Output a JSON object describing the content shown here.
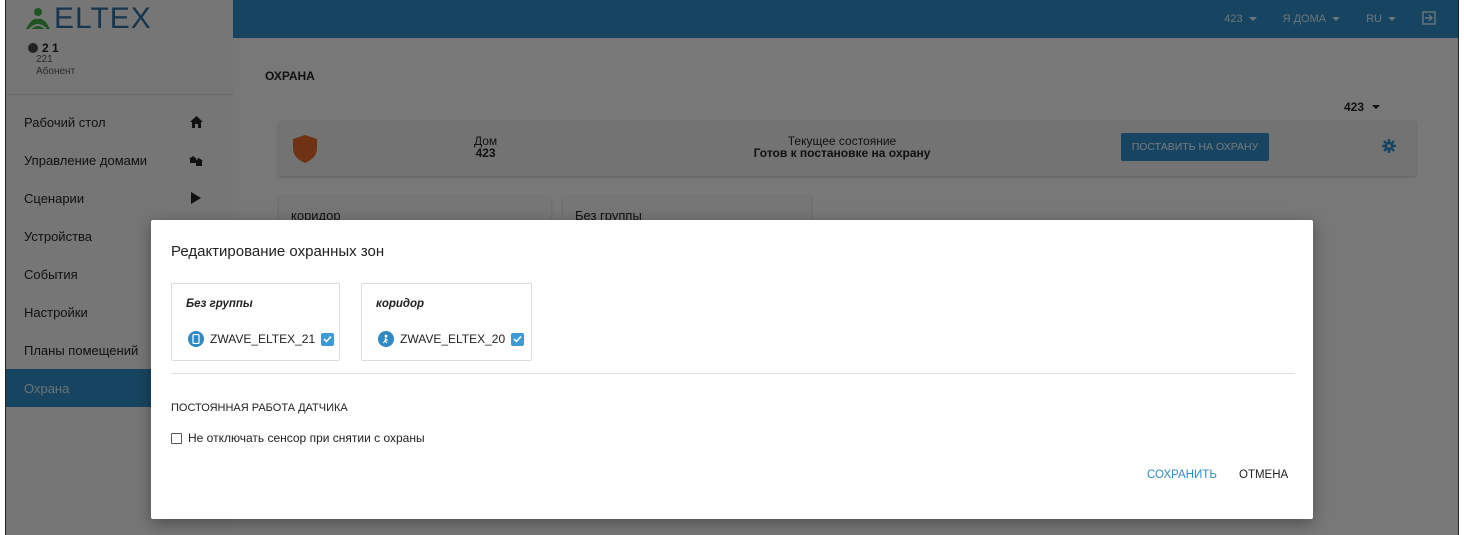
{
  "app": {
    "logo_text": "ELTEX",
    "user_number": "2 1",
    "user_id": "221",
    "user_role": "Абонент"
  },
  "sidebar": {
    "items": [
      {
        "label": "Рабочий стол",
        "icon": "home-icon"
      },
      {
        "label": "Управление домами",
        "icon": "houses-icon"
      },
      {
        "label": "Сценарии",
        "icon": "play-icon"
      },
      {
        "label": "Устройства",
        "icon": ""
      },
      {
        "label": "События",
        "icon": ""
      },
      {
        "label": "Настройки",
        "icon": ""
      },
      {
        "label": "Планы помещений",
        "icon": ""
      },
      {
        "label": "Охрана",
        "icon": "",
        "active": true
      }
    ]
  },
  "topbar": {
    "house": "423",
    "mode": "Я ДОМА",
    "lang": "RU",
    "logout_icon": "logout-icon"
  },
  "page": {
    "title": "ОХРАНА",
    "house_selector": "423",
    "guard": {
      "house_label": "Дом",
      "house_value": "423",
      "state_label": "Текущее состояние",
      "state_value": "Готов к постановке на охрану",
      "arm_button": "ПОСТАВИТЬ НА ОХРАНУ"
    },
    "zone_cards": [
      "коридор",
      "Без группы"
    ]
  },
  "modal": {
    "title": "Редактирование охранных зон",
    "zones": [
      {
        "title": "Без группы",
        "device": "ZWAVE_ELTEX_21",
        "checked": true,
        "icon": "door-sensor-icon"
      },
      {
        "title": "коридор",
        "device": "ZWAVE_ELTEX_20",
        "checked": true,
        "icon": "motion-sensor-icon"
      }
    ],
    "permanent_title": "ПОСТОЯННАЯ РАБОТА ДАТЧИКА",
    "permanent_checkbox_label": "Не отключать сенсор при снятии с охраны",
    "permanent_checked": false,
    "save_label": "СОХРАНИТЬ",
    "cancel_label": "ОТМЕНА"
  },
  "colors": {
    "accent": "#2f8ac3",
    "shield": "#e0652b"
  }
}
